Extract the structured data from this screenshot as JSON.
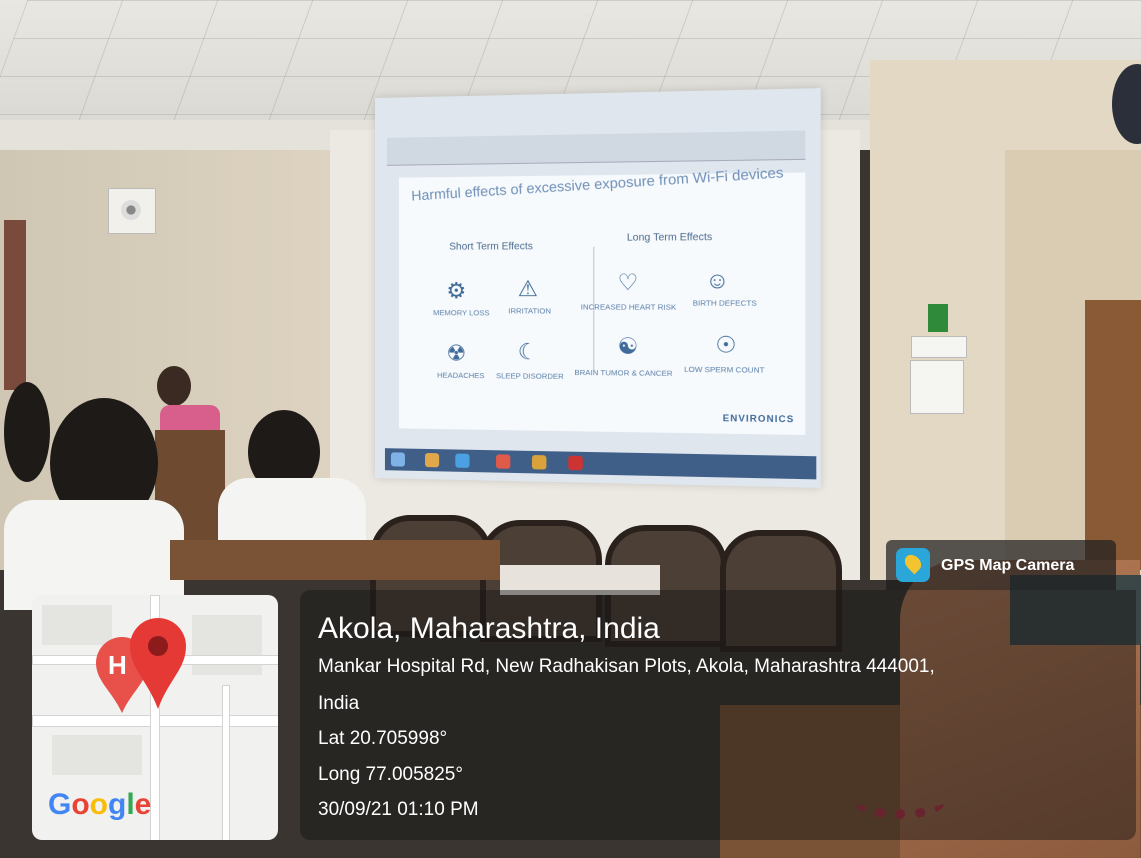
{
  "slide": {
    "title": "Harmful effects of excessive exposure from Wi-Fi devices",
    "short_term_heading": "Short Term Effects",
    "long_term_heading": "Long Term Effects",
    "short_term_effects": [
      "MEMORY LOSS",
      "IRRITATION",
      "HEADACHES",
      "SLEEP DISORDER"
    ],
    "long_term_effects": [
      "INCREASED HEART RISK",
      "BIRTH DEFECTS",
      "BRAIN TUMOR & CANCER",
      "LOW SPERM COUNT"
    ],
    "logo": "ENVIRONICS"
  },
  "gps": {
    "app_name": "GPS Map Camera",
    "location_title": "Akola, Maharashtra, India",
    "address_line1": "Mankar Hospital Rd, New Radhakisan Plots, Akola, Maharashtra 444001,",
    "address_line2": "India",
    "latitude": "Lat 20.705998°",
    "longitude": "Long 77.005825°",
    "datetime": "30/09/21 01:10 PM"
  },
  "map": {
    "hospital_marker": "H",
    "brand": [
      "G",
      "o",
      "o",
      "g",
      "l",
      "e"
    ]
  }
}
